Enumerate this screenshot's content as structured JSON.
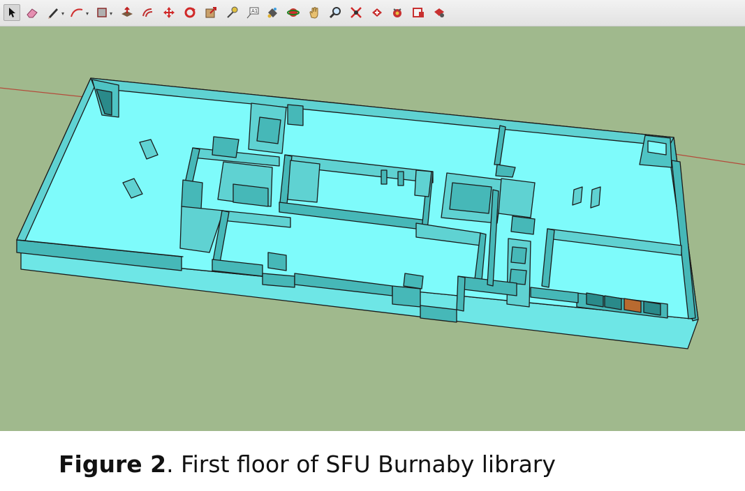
{
  "toolbar": {
    "tools": [
      {
        "icon": "select-arrow-icon",
        "active": true
      },
      {
        "icon": "eraser-icon"
      },
      {
        "icon": "pencil-line-icon",
        "dropdown": true
      },
      {
        "icon": "arc-icon",
        "dropdown": true
      },
      {
        "icon": "rectangle-shape-icon",
        "dropdown": true
      },
      {
        "icon": "push-pull-icon"
      },
      {
        "icon": "offset-icon"
      },
      {
        "icon": "move-icon"
      },
      {
        "icon": "rotate-icon"
      },
      {
        "icon": "scale-icon"
      },
      {
        "icon": "tape-measure-icon"
      },
      {
        "icon": "text-label-icon"
      },
      {
        "icon": "paint-bucket-icon"
      },
      {
        "icon": "orbit-icon"
      },
      {
        "icon": "pan-hand-icon"
      },
      {
        "icon": "zoom-icon"
      },
      {
        "icon": "zoom-extents-icon"
      },
      {
        "icon": "warehouse-get-models-icon"
      },
      {
        "icon": "warehouse-share-model-icon"
      },
      {
        "icon": "extension-warehouse-icon"
      },
      {
        "icon": "layout-send-icon"
      }
    ]
  },
  "colors": {
    "toolbar_bg": "#e8e8e8",
    "ground": "#a0b98d",
    "floor": "#7efbfb",
    "wall_top": "#5fd2d2",
    "wall_side": "#46b8b8",
    "outline": "#1a1a1a",
    "axis_red": "#b44a3a"
  },
  "caption": {
    "label": "Figure 2",
    "text": ". First floor of SFU Burnaby library"
  }
}
